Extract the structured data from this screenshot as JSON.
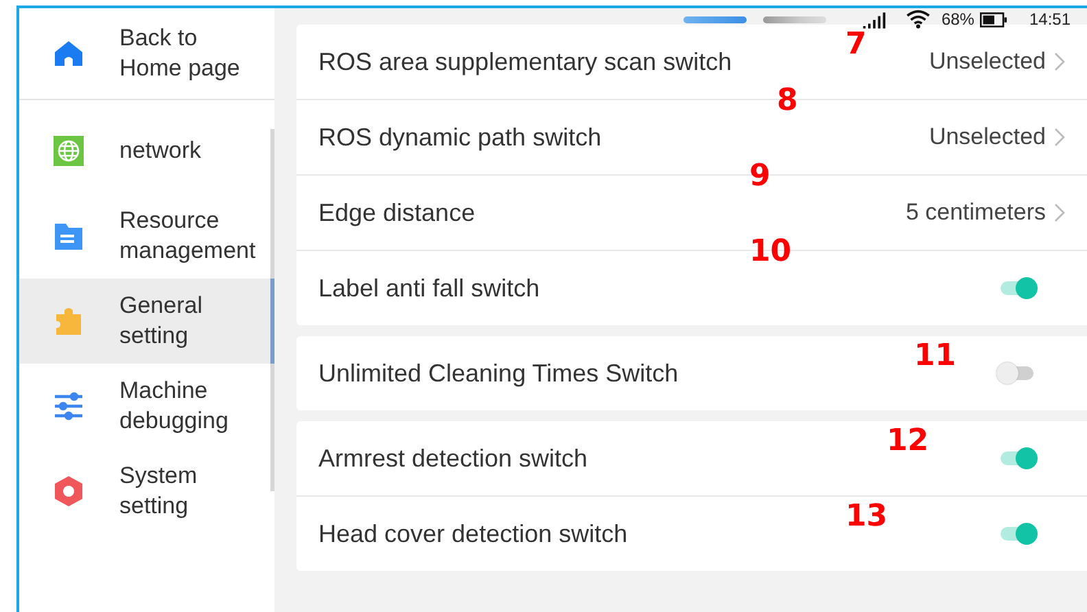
{
  "sidebar": {
    "items": [
      {
        "label": "Back to Home page",
        "selected": false
      },
      {
        "label": "network",
        "selected": false
      },
      {
        "label": "Resource management",
        "selected": false
      },
      {
        "label": "General setting",
        "selected": true
      },
      {
        "label": "Machine debugging",
        "selected": false
      },
      {
        "label": "System setting",
        "selected": false
      }
    ]
  },
  "status_bar": {
    "battery": "68%",
    "time": "14:51"
  },
  "groups": [
    {
      "rows": [
        {
          "kind": "value",
          "label": "ROS area supplementary scan switch",
          "value": "Unselected",
          "marker": "7"
        },
        {
          "kind": "value",
          "label": "ROS dynamic path switch",
          "value": "Unselected",
          "marker": "8"
        },
        {
          "kind": "value",
          "label": "Edge distance",
          "value": "5 centimeters",
          "marker": "9"
        },
        {
          "kind": "toggle",
          "label": "Label anti fall switch",
          "on": true,
          "marker": "10"
        }
      ]
    },
    {
      "rows": [
        {
          "kind": "toggle",
          "label": "Unlimited Cleaning Times Switch",
          "on": false,
          "marker": "11"
        }
      ]
    },
    {
      "rows": [
        {
          "kind": "toggle",
          "label": "Armrest detection switch",
          "on": true,
          "marker": "12"
        },
        {
          "kind": "toggle",
          "label": "Head cover detection switch",
          "on": true,
          "marker": "13"
        }
      ]
    }
  ]
}
